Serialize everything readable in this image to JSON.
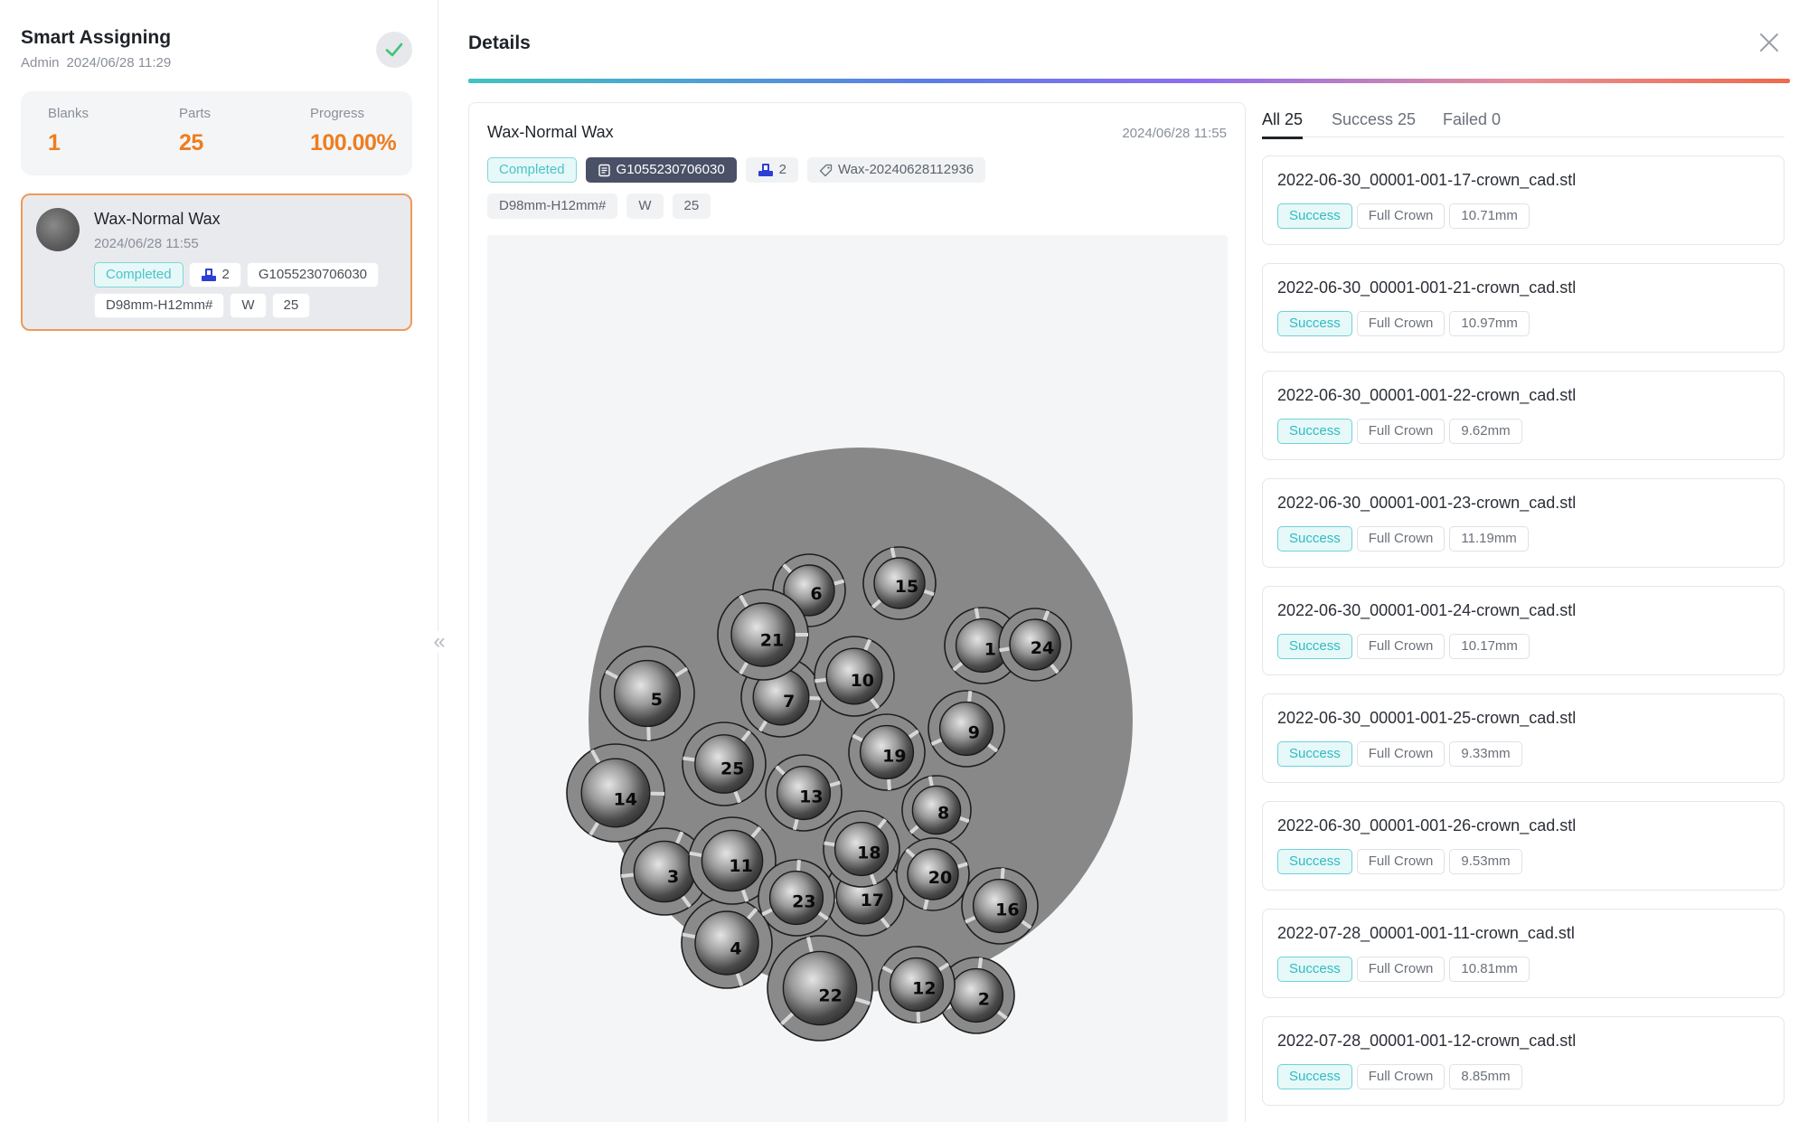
{
  "left_panel": {
    "title": "Smart Assigning",
    "user": "Admin",
    "timestamp": "2024/06/28 11:29",
    "status_icon": "check-icon",
    "stats": {
      "blanks_label": "Blanks",
      "blanks_value": "1",
      "parts_label": "Parts",
      "parts_value": "25",
      "progress_label": "Progress",
      "progress_value": "100.00%"
    },
    "job": {
      "name": "Wax-Normal Wax",
      "date": "2024/06/28 11:55",
      "status": "Completed",
      "count": "2",
      "code": "G1055230706030",
      "size": "D98mm-H12mm#",
      "material": "W",
      "parts": "25"
    }
  },
  "details": {
    "title": "Details",
    "card": {
      "name": "Wax-Normal Wax",
      "date": "2024/06/28 11:55",
      "status": "Completed",
      "code": "G1055230706030",
      "count": "2",
      "batch": "Wax-20240628112936",
      "size": "D98mm-H12mm#",
      "material": "W",
      "parts": "25"
    },
    "nest_labels": [
      "1",
      "2",
      "3",
      "4",
      "5",
      "6",
      "7",
      "8",
      "9",
      "10",
      "11",
      "12",
      "13",
      "14",
      "15",
      "16",
      "17",
      "18",
      "19",
      "20",
      "21",
      "22",
      "23",
      "24",
      "25"
    ]
  },
  "tabs": {
    "all": "All 25",
    "success": "Success 25",
    "failed": "Failed 0"
  },
  "results": [
    {
      "file": "2022-06-30_00001-001-17-crown_cad.stl",
      "status": "Success",
      "type": "Full Crown",
      "size": "10.71mm"
    },
    {
      "file": "2022-06-30_00001-001-21-crown_cad.stl",
      "status": "Success",
      "type": "Full Crown",
      "size": "10.97mm"
    },
    {
      "file": "2022-06-30_00001-001-22-crown_cad.stl",
      "status": "Success",
      "type": "Full Crown",
      "size": "9.62mm"
    },
    {
      "file": "2022-06-30_00001-001-23-crown_cad.stl",
      "status": "Success",
      "type": "Full Crown",
      "size": "11.19mm"
    },
    {
      "file": "2022-06-30_00001-001-24-crown_cad.stl",
      "status": "Success",
      "type": "Full Crown",
      "size": "10.17mm"
    },
    {
      "file": "2022-06-30_00001-001-25-crown_cad.stl",
      "status": "Success",
      "type": "Full Crown",
      "size": "9.33mm"
    },
    {
      "file": "2022-06-30_00001-001-26-crown_cad.stl",
      "status": "Success",
      "type": "Full Crown",
      "size": "9.53mm"
    },
    {
      "file": "2022-07-28_00001-001-11-crown_cad.stl",
      "status": "Success",
      "type": "Full Crown",
      "size": "10.81mm"
    },
    {
      "file": "2022-07-28_00001-001-12-crown_cad.stl",
      "status": "Success",
      "type": "Full Crown",
      "size": "8.85mm"
    }
  ]
}
